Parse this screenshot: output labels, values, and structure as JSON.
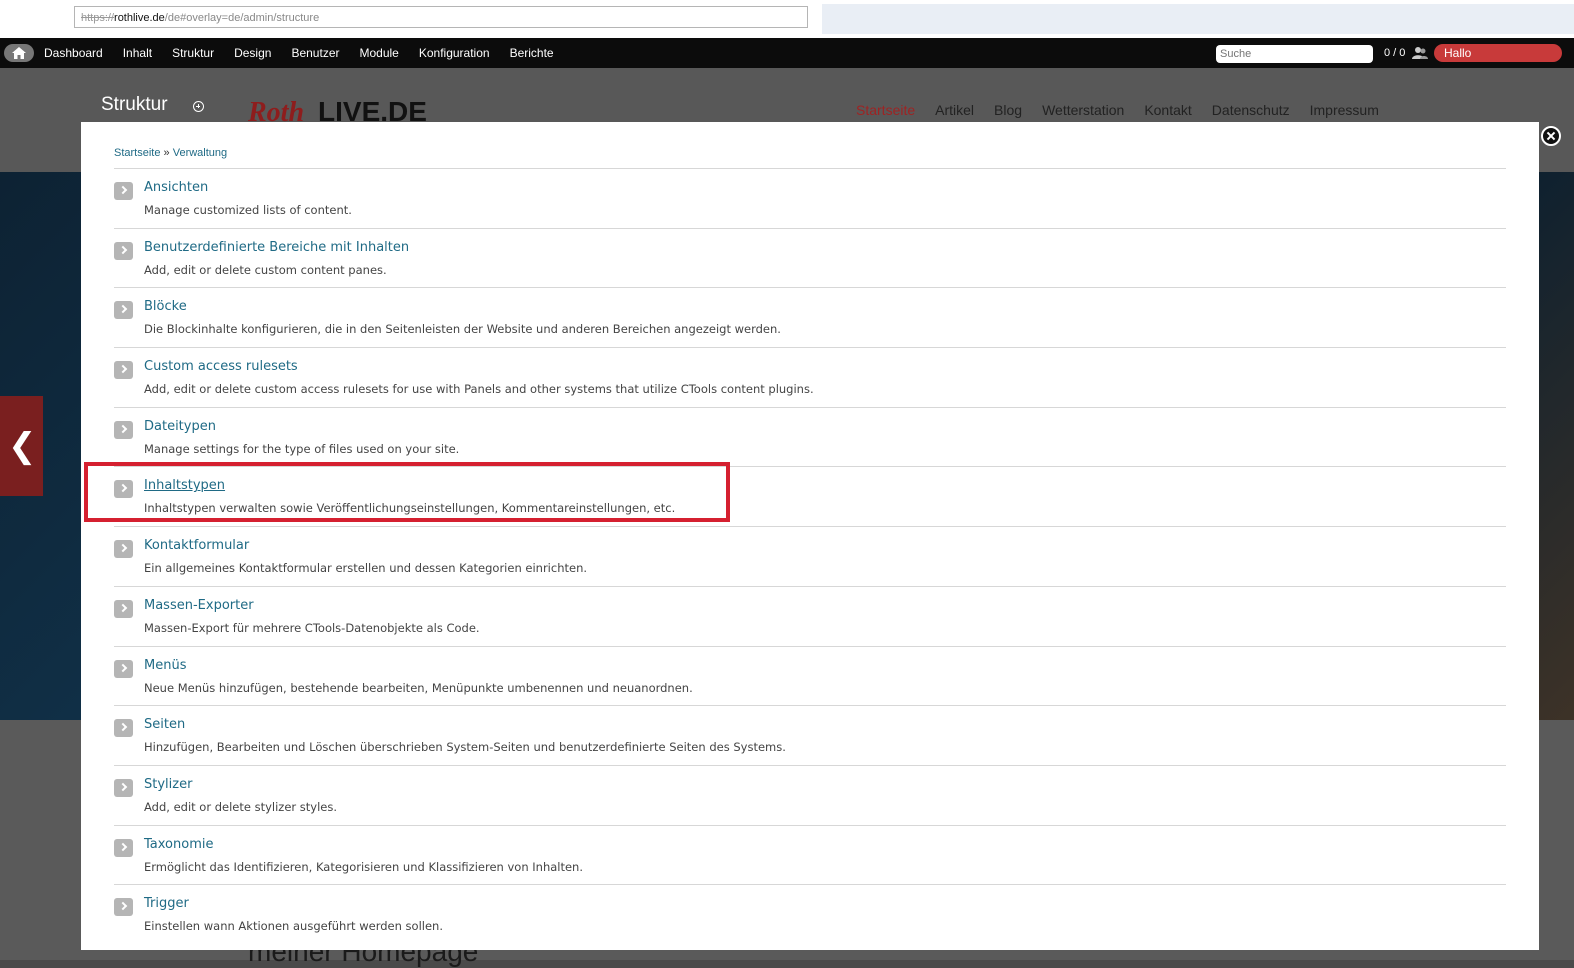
{
  "browser": {
    "url_scheme": "https://",
    "url_host": "rothlive.de",
    "url_path": "/de#overlay=de/admin/structure"
  },
  "toolbar": {
    "menu": [
      "Dashboard",
      "Inhalt",
      "Struktur",
      "Design",
      "Benutzer",
      "Module",
      "Konfiguration",
      "Berichte"
    ],
    "search_placeholder": "Suche",
    "counter": "0 / 0",
    "user_greeting": "Hallo"
  },
  "site": {
    "logo_roth": "Roth",
    "logo_live": "LIVE.DE",
    "nav": [
      "Startseite",
      "Artikel",
      "Blog",
      "Wetterstation",
      "Kontakt",
      "Datenschutz",
      "Impressum"
    ],
    "nav_active": "Startseite",
    "bottom_text": "meiner Homepage"
  },
  "overlay": {
    "title": "Struktur",
    "breadcrumb": [
      "Startseite",
      "Verwaltung"
    ],
    "breadcrumb_separator": "»",
    "highlight_color": "#d52030",
    "items": [
      {
        "title": "Ansichten",
        "desc": "Manage customized lists of content."
      },
      {
        "title": "Benutzerdefinierte Bereiche mit Inhalten",
        "desc": "Add, edit or delete custom content panes."
      },
      {
        "title": "Blöcke",
        "desc": "Die Blockinhalte konfigurieren, die in den Seitenleisten der Website und anderen Bereichen angezeigt werden."
      },
      {
        "title": "Custom access rulesets",
        "desc": "Add, edit or delete custom access rulesets for use with Panels and other systems that utilize CTools content plugins."
      },
      {
        "title": "Dateitypen",
        "desc": "Manage settings for the type of files used on your site."
      },
      {
        "title": "Inhaltstypen",
        "desc": "Inhaltstypen verwalten sowie Veröffentlichungseinstellungen, Kommentareinstellungen, etc.",
        "highlighted": true
      },
      {
        "title": "Kontaktformular",
        "desc": "Ein allgemeines Kontaktformular erstellen und dessen Kategorien einrichten."
      },
      {
        "title": "Massen-Exporter",
        "desc": "Massen-Export für mehrere CTools-Datenobjekte als Code."
      },
      {
        "title": "Menüs",
        "desc": "Neue Menüs hinzufügen, bestehende bearbeiten, Menüpunkte umbenennen und neuanordnen."
      },
      {
        "title": "Seiten",
        "desc": "Hinzufügen, Bearbeiten und Löschen überschrieben System-Seiten und benutzerdefinierte Seiten des Systems."
      },
      {
        "title": "Stylizer",
        "desc": "Add, edit or delete stylizer styles."
      },
      {
        "title": "Taxonomie",
        "desc": "Ermöglicht das Identifizieren, Kategorisieren und Klassifizieren von Inhalten."
      },
      {
        "title": "Trigger",
        "desc": "Einstellen wann Aktionen ausgeführt werden sollen."
      }
    ]
  }
}
